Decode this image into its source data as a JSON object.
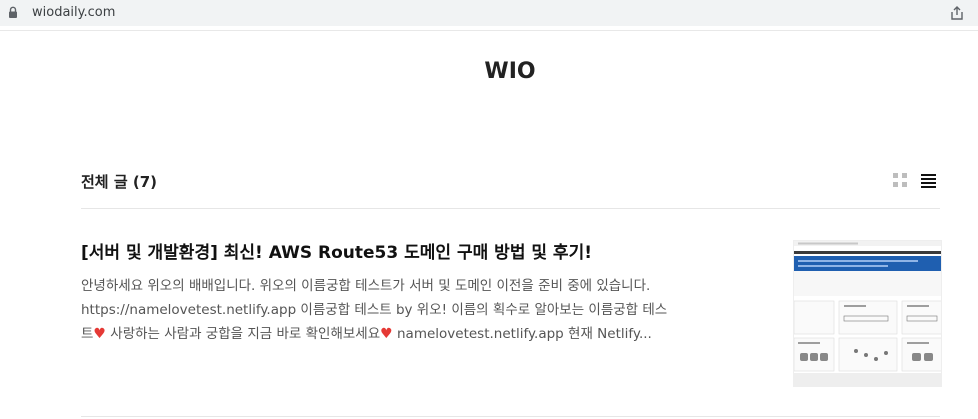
{
  "browser": {
    "url": "wiodaily.com"
  },
  "site": {
    "title": "WIO"
  },
  "list": {
    "header": "전체 글 (7)"
  },
  "post": {
    "title": "[서버 및 개발환경] 최신! AWS Route53 도메인 구매 방법 및 후기!",
    "excerpt_line1": "안녕하세요 위오의 배배입니다. 위오의 이름궁합 테스트가 서버 및 도메인 이전을 준비 중에 있습니다.",
    "excerpt_line2": "https://namelovetest.netlify.app 이름궁합 테스트 by 위오! 이름의 획수로 알아보는 이름궁합 테스",
    "excerpt_line3_a": "트",
    "excerpt_line3_b": " 사랑하는 사람과 궁합을 지금 바로 확인해보세요",
    "excerpt_line3_c": " namelovetest.netlify.app 현재 Netlify...",
    "heart": "♥"
  },
  "icons": {
    "lock": "lock-icon",
    "share": "share-icon",
    "grid_view": "grid-view-icon",
    "list_view": "list-view-icon",
    "heart": "heart-icon"
  },
  "colors": {
    "heart": "#e53935",
    "title": "#111111",
    "excerpt": "#555555",
    "thumbnail_header": "#1f5fb0"
  }
}
